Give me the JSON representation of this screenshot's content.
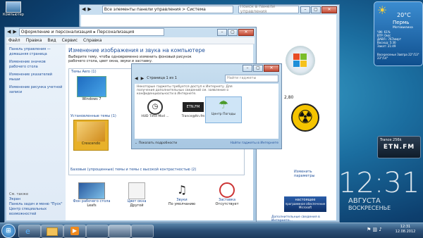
{
  "desktop": {
    "icon_label": "Компьютер",
    "clock_big": "12:31",
    "clock_month": "АВГУСТА",
    "clock_day": "ВОСКРЕСЕНЬЕ"
  },
  "weather": {
    "temp": "20°C",
    "city": "Пермь",
    "district": "Мотовилиха",
    "rows": [
      "ЧЖ: 61%",
      "ВТР: 0м/с",
      "ДАВЛ.: 767ммрт",
      "Восход: 5:30",
      "Закат: 21:49"
    ],
    "forecast": "Воскресенье Завтра 22°/13° 23°/14°"
  },
  "sysinfo_window": {
    "address": "Все элементы панели управления  >  Система",
    "search_placeholder": "Поиск в панели управления",
    "score": "2,80",
    "change_link": "Изменить параметры",
    "badge_line1": "настоящее",
    "badge_line2": "программное обеспечение",
    "badge_line3": "Microsoft",
    "footer_link": "Дополнительные сведения в Интернете..."
  },
  "personalize_window": {
    "address_part1": "Оформление и персонализация",
    "address_part2": "Персонализация",
    "menu": [
      "Файл",
      "Правка",
      "Вид",
      "Сервис",
      "Справка"
    ],
    "sidebar": [
      "Панель управления — домашняя страница",
      "Изменение значков рабочего стола",
      "Изменение указателей мыши",
      "Изменение рисунка учетной записи"
    ],
    "see_also_title": "См. также",
    "see_also": [
      "Экран",
      "Панель задач и меню \"Пуск\"",
      "Центр специальных возможностей"
    ],
    "heading": "Изменение изображения и звука на компьютере",
    "subtext": "Выберите тему, чтобы одновременно изменить фоновый рисунок рабочего стола, цвет окна, звуки и заставку.",
    "aero_section": "Темы Aero (1)",
    "aero_theme_name": "Windows 7",
    "installed_section": "Установленные темы (1)",
    "installed_theme_name": "Crescendo",
    "basic_section": "Базовые (упрощенные) темы и темы с высокой контрастностью (2)",
    "bottom": [
      {
        "title": "Фон рабочего стола",
        "value": "Leafs"
      },
      {
        "title": "Цвет окна",
        "value": "Другой"
      },
      {
        "title": "Звуки",
        "value": "По умолчанию"
      },
      {
        "title": "Заставка",
        "value": "Отсутствует"
      }
    ]
  },
  "gadgets_window": {
    "page": "Страница 1 из 1",
    "search_placeholder": "Найти гаджеты",
    "notice": "Некоторые гаджеты требуется доступ к Интернету. Для получения дополнительных сведений см. заявление о конфиденциальности в Интернете.",
    "items": [
      "HUD Time Mod ...",
      "Trance@Itn.fm",
      "Центр Погоды"
    ],
    "details_label": "Показать подробности",
    "online_link": "Найти гаджеты в Интернете"
  },
  "radio_gadget": {
    "title": "Trance 256k",
    "logo": "ETN.FM"
  },
  "taskbar": {
    "time": "12:31",
    "date": "12.08.2012"
  },
  "colors": {
    "accent_link": "#1e4f9a",
    "heading_orange": "#d9602a"
  }
}
